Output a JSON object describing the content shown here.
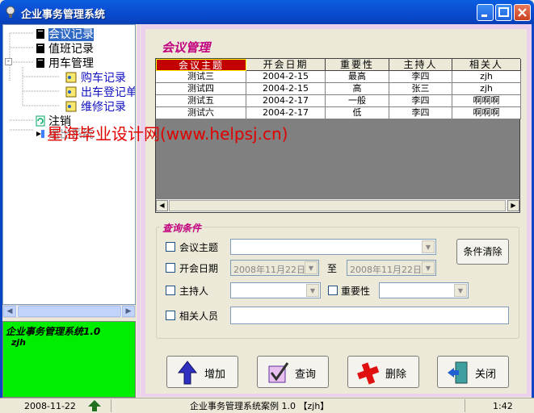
{
  "window": {
    "title": "企业事务管理系统"
  },
  "tree": {
    "items": [
      {
        "label": "会议记录",
        "selected": true
      },
      {
        "label": "值班记录"
      },
      {
        "label": "用车管理"
      },
      {
        "label": "购车记录"
      },
      {
        "label": "出车登记单"
      },
      {
        "label": "维修记录"
      },
      {
        "label": "注销"
      },
      {
        "label": "退出系统"
      }
    ],
    "expander": "-"
  },
  "infobox": {
    "line1": "企业事务管理系统1.0",
    "line2": "zjh",
    "bg_color": "#00ee00"
  },
  "panel": {
    "title": "会议管理"
  },
  "grid": {
    "columns": [
      "会议主题",
      "开会日期",
      "重要性",
      "主持人",
      "相关人"
    ],
    "rows": [
      [
        "测试三",
        "2004-2-15",
        "最高",
        "李四",
        "zjh"
      ],
      [
        "测试四",
        "2004-2-15",
        "高",
        "张三",
        "zjh"
      ],
      [
        "测试五",
        "2004-2-17",
        "一般",
        "李四",
        "啊啊啊"
      ],
      [
        "测试六",
        "2004-2-17",
        "低",
        "李四",
        "啊啊啊"
      ]
    ]
  },
  "watermark": "星海毕业设计网(www.helpsj.cn)",
  "query": {
    "legend": "查询条件",
    "topic_label": "会议主题",
    "date_label": "开会日期",
    "date_from": "2008年11月22日",
    "date_to_label": "至",
    "date_to": "2008年11月22日",
    "host_label": "主持人",
    "importance_label": "重要性",
    "related_label": "相关人员",
    "clear_label": "条件清除"
  },
  "buttons": {
    "add": "增加",
    "search": "查询",
    "delete": "删除",
    "close": "关闭"
  },
  "status": {
    "date": "2008-11-22",
    "center": "企业事务管理系统案例  1.0  【zjh】",
    "time": "1:42"
  },
  "colors": {
    "accent": "#c2007f",
    "header_sel": "#c20000",
    "title_bar": "#0845c4"
  }
}
